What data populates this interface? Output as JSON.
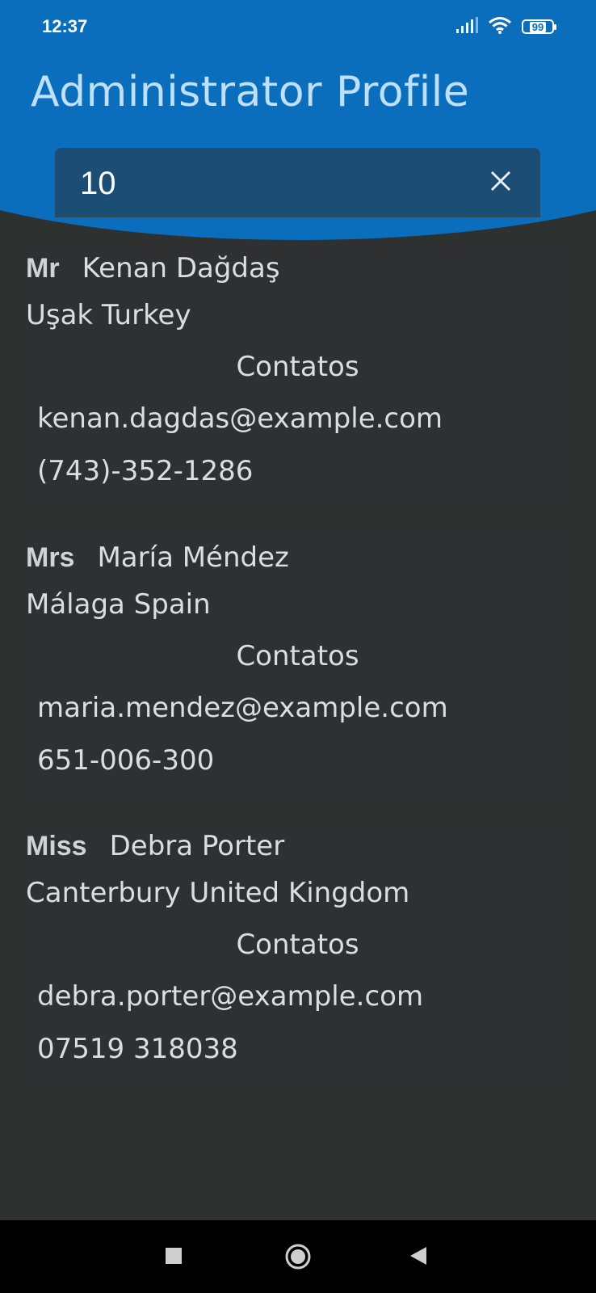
{
  "status_bar": {
    "time": "12:37",
    "battery": "99"
  },
  "header": {
    "title": "Administrator Profile"
  },
  "search": {
    "value": "10"
  },
  "profiles": [
    {
      "salutation": "Mr",
      "name": "Kenan  Dağdaş",
      "location": "Uşak  Turkey",
      "contacts_label": "Contatos",
      "email": "kenan.dagdas@example.com",
      "phone": "(743)-352-1286"
    },
    {
      "salutation": "Mrs",
      "name": "María  Méndez",
      "location": "Málaga  Spain",
      "contacts_label": "Contatos",
      "email": "maria.mendez@example.com",
      "phone": "651-006-300"
    },
    {
      "salutation": "Miss",
      "name": "Debra  Porter",
      "location": "Canterbury  United Kingdom",
      "contacts_label": "Contatos",
      "email": "debra.porter@example.com",
      "phone": "07519 318038"
    }
  ],
  "colors": {
    "header_blue": "#0a6ebd",
    "title_text": "#bfe0fb",
    "background": "#2d312f",
    "card": "#2e3032",
    "search_field": "#1b4d75"
  },
  "icons": {
    "clear": "close-icon",
    "signal": "signal-icon",
    "wifi": "wifi-icon",
    "battery": "battery-icon",
    "nav_recent": "square-icon",
    "nav_home": "circle-icon",
    "nav_back": "triangle-back-icon"
  }
}
